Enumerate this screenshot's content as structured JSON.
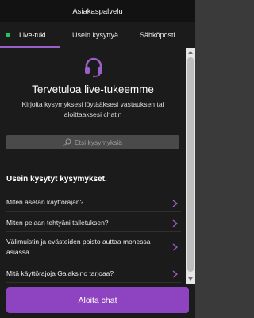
{
  "header": {
    "title": "Asiakaspalvelu"
  },
  "tabs": [
    {
      "label": "Live-tuki",
      "active": true
    },
    {
      "label": "Usein kysyttyä",
      "active": false
    },
    {
      "label": "Sähköposti",
      "active": false
    }
  ],
  "welcome": {
    "icon": "headset-icon",
    "title": "Tervetuloa live-tukeemme",
    "description": "Kirjoita kysymyksesi löytääksesi vastauksen tai aloittaaksesi chatin"
  },
  "search": {
    "placeholder": "Etsi kysymyksiä"
  },
  "faq": {
    "title": "Usein kysytyt kysymykset.",
    "items": [
      {
        "question": "Miten asetan käyttörajan?"
      },
      {
        "question": "Miten pelaan tehtyäni talletuksen?"
      },
      {
        "question": "Välimuistin ja evästeiden poisto auttaa monessa asiassa..."
      },
      {
        "question": "Mitä käyttörajoja Galaksino tarjoaa?"
      }
    ]
  },
  "footer": {
    "start_chat_label": "Aloita chat"
  },
  "colors": {
    "accent": "#8e44c0",
    "online": "#22c55e",
    "background": "#1b1b1b",
    "header": "#121212"
  }
}
